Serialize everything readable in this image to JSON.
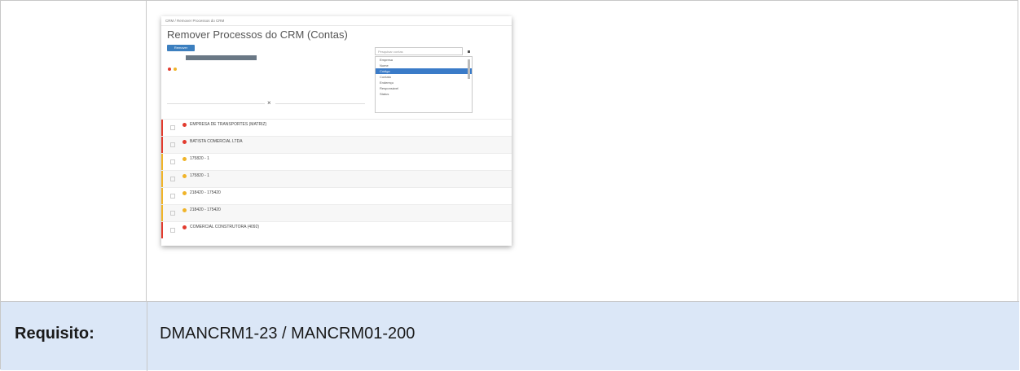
{
  "requirement": {
    "label": "Requisito:",
    "value": "DMANCRM1-23 / MANCRM01-200"
  },
  "colors": {
    "row_bg": "#dbe7f7",
    "accent_blue": "#3c7fbf",
    "red": "#e23b2e",
    "yellow": "#f0b429"
  },
  "screenshot": {
    "breadcrumb": "CRM / Remover Processos do CRM",
    "title": "Remover Processos do CRM (Contas)",
    "remove_button": "Remover",
    "search_placeholder": "Pesquisar contas",
    "dropdown_items": [
      "Empresa",
      "Nome",
      "Código",
      "Contato",
      "Endereço",
      "Responsável",
      "Status"
    ],
    "selected_index": 2,
    "rows": [
      {
        "name": "EMPRESA DE TRANSPORTES (MATRIZ)",
        "color": "red"
      },
      {
        "name": "BATISTA COMERCIAL LTDA",
        "color": "red"
      },
      {
        "name": "175820 - 1",
        "color": "yellow"
      },
      {
        "name": "175820 - 1",
        "color": "yellow"
      },
      {
        "name": "218420 - 175420",
        "color": "yellow"
      },
      {
        "name": "218420 - 175420",
        "color": "yellow"
      },
      {
        "name": "COMERCIAL CONSTRUTORA (4092)",
        "color": "red"
      }
    ]
  }
}
